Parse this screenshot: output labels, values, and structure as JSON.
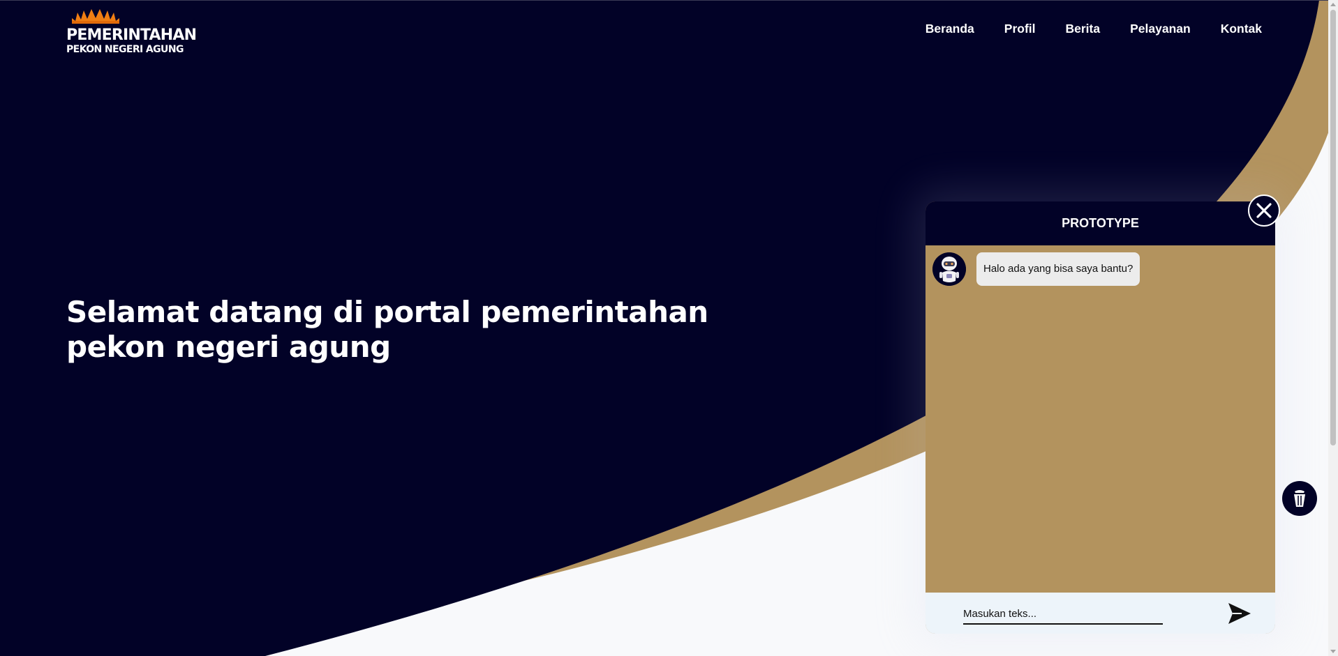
{
  "brand": {
    "title": "PEMERINTAHAN",
    "subtitle": "PEKON NEGERI AGUNG",
    "logo_icon": "crown-emblem-icon"
  },
  "nav": {
    "items": [
      {
        "label": "Beranda"
      },
      {
        "label": "Profil"
      },
      {
        "label": "Berita"
      },
      {
        "label": "Pelayanan"
      },
      {
        "label": "Kontak"
      }
    ]
  },
  "hero": {
    "line1": "Selamat datang di portal pemerintahan",
    "line2": "pekon negeri agung"
  },
  "chat": {
    "title": "PROTOTYPE",
    "greeting": "Halo ada yang bisa saya bantu?",
    "input_placeholder": "Masukan teks...",
    "input_value": "",
    "avatar_icon": "robot-avatar-icon",
    "send_icon": "send-icon",
    "close_icon": "close-icon",
    "launcher_icon": "lamp-icon"
  },
  "colors": {
    "navy": "#020227",
    "gold": "#b3935e",
    "logo_orange": "#f07e13",
    "white": "#ffffff"
  }
}
